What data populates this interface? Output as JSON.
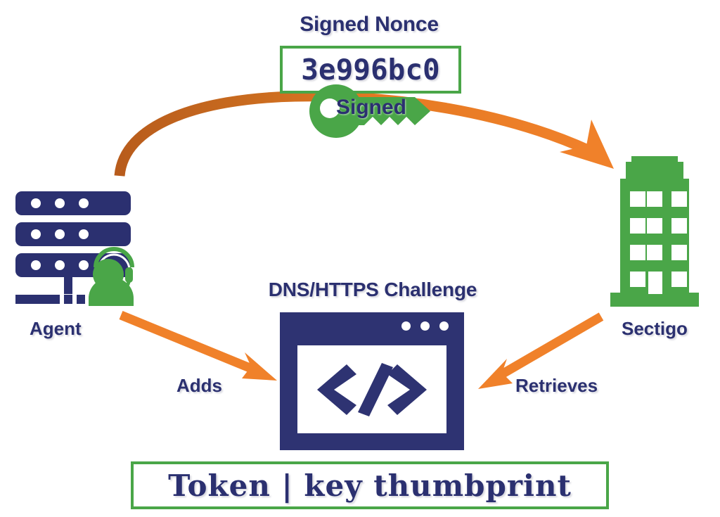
{
  "diagram": {
    "title": "DNS/HTTPS Challenge flow between Agent and Sectigo",
    "colors": {
      "navy": "#2b3070",
      "green": "#4aa648",
      "orange": "#f0812a",
      "orange_dark": "#bf631f",
      "white": "#ffffff"
    },
    "nodes": {
      "agent": {
        "label": "Agent",
        "icon": "server-stack-with-support-agent-icon"
      },
      "sectigo": {
        "label": "Sectigo",
        "icon": "office-building-icon"
      },
      "challenge": {
        "title": "DNS/HTTPS Challenge",
        "icon": "browser-window-code-icon",
        "code_glyph": "</>"
      }
    },
    "nonce": {
      "title": "Signed Nonce",
      "value": "3e996bc0",
      "key_label": "Signed",
      "key_icon": "key-icon"
    },
    "token": {
      "value": "Token | key thumbprint"
    },
    "arrows": {
      "signed_nonce": {
        "label": "",
        "from": "Agent",
        "to": "Sectigo",
        "style": "curved"
      },
      "adds": {
        "label": "Adds",
        "from": "Agent",
        "to": "DNS/HTTPS Challenge",
        "style": "straight"
      },
      "retrieves": {
        "label": "Retrieves",
        "from": "Sectigo",
        "to": "DNS/HTTPS Challenge",
        "style": "straight"
      }
    }
  }
}
